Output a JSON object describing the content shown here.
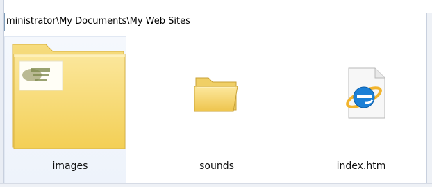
{
  "address": {
    "path": "ministrator\\My Documents\\My Web Sites"
  },
  "items": [
    {
      "label": "images",
      "icon": "folder-with-images-icon"
    },
    {
      "label": "sounds",
      "icon": "folder-icon"
    },
    {
      "label": "index.htm",
      "icon": "internet-explorer-html-file-icon"
    }
  ],
  "colors": {
    "folder_yellow": "#f7d76a",
    "address_border": "#7f9db9",
    "ie_blue": "#1b7fd6"
  }
}
